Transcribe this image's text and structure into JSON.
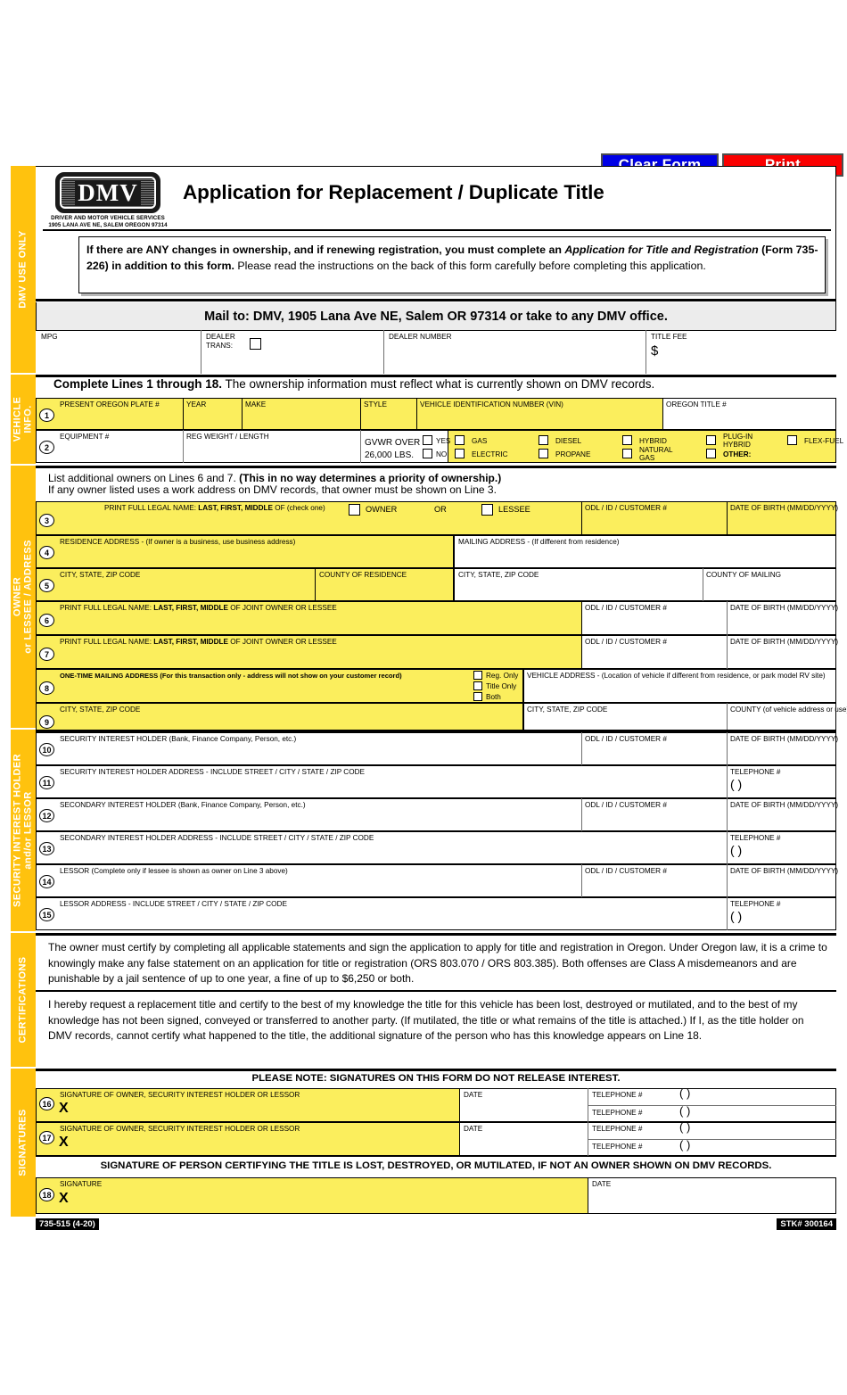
{
  "buttons": {
    "clear": "Clear Form",
    "print": "Print"
  },
  "header": {
    "logo_word": "DMV",
    "logo_sub_line1": "DRIVER AND MOTOR VEHICLE SERVICES",
    "logo_sub_line2": "1905 LANA AVE NE, SALEM OREGON 97314",
    "title": "Application for Replacement / Duplicate Title",
    "notice_html": "If there are ANY changes in ownership, and if renewing registration, you must complete an Application for Title and Registration (Form 735-226) in addition to this form. Please read the instructions on the back of this form carefully before completing this application.",
    "notice_b1": "If there are ANY changes in ownership, and if renewing registration, you must complete an ",
    "notice_i1": "Application for Title and Registration",
    "notice_b2": " (Form 735-226) in addition to this form. ",
    "notice_n1": "Please read the instructions on the back of this form carefully before completing this application.",
    "mail_to": "Mail to: DMV, 1905 Lana Ave NE, Salem OR 97314 or take to any DMV office."
  },
  "sidebars": {
    "dmv_use_only": "DMV USE ONLY",
    "vehicle_info_l1": "VEHICLE",
    "vehicle_info_l2": "INFO.",
    "owner_l1": "OWNER",
    "owner_l2": "or LESSEE / ADDRESS",
    "security_l1": "SECURITY INTEREST HOLDER",
    "security_l2": "and/or LESSOR",
    "certifications": "CERTIFICATIONS",
    "signatures": "SIGNATURES"
  },
  "dmv_use": {
    "mpg": "MPG",
    "dealer_trans_l1": "DEALER",
    "dealer_trans_l2": "TRANS:",
    "dealer_number": "DEALER NUMBER",
    "title_fee": "TITLE FEE",
    "dollar": "$"
  },
  "vehicle": {
    "complete_bold": "Complete Lines 1 through 18.",
    "complete_rest": " The ownership information must reflect what is currently shown on DMV records.",
    "line1": {
      "num": "1",
      "plate": "PRESENT OREGON PLATE #",
      "year": "YEAR",
      "make": "MAKE",
      "style": "STYLE",
      "vin": "VEHICLE IDENTIFICATION NUMBER (VIN)",
      "title_no": "OREGON TITLE #"
    },
    "line2": {
      "num": "2",
      "equipment": "EQUIPMENT #",
      "reg_weight": "REG WEIGHT / LENGTH",
      "gvwr_l1": "GVWR OVER",
      "gvwr_l2": "26,000 LBS.",
      "yes": "YES",
      "no": "NO",
      "fuels": [
        "GAS",
        "DIESEL",
        "HYBRID",
        "PLUG-IN HYBRID",
        "FLEX-FUEL",
        "ELECTRIC",
        "PROPANE",
        "NATURAL GAS",
        "OTHER:"
      ],
      "gas": "GAS",
      "diesel": "DIESEL",
      "hybrid": "HYBRID",
      "plugin_l1": "PLUG-IN",
      "plugin_l2": "HYBRID",
      "flexfuel": "FLEX-FUEL",
      "electric": "ELECTRIC",
      "propane": "PROPANE",
      "natural_l1": "NATURAL",
      "natural_l2": "GAS",
      "other": "OTHER:"
    }
  },
  "owner": {
    "note_l1_a": "List additional owners on Lines 6 and 7.  ",
    "note_l1_b": "(This in no way determines a priority of ownership.)",
    "note_l2": "If any owner listed uses a work address on DMV records, that owner must be shown on Line 3.",
    "line3": {
      "num": "3",
      "label_a": "PRINT FULL LEGAL NAME: ",
      "label_b": "LAST, FIRST, MIDDLE",
      "label_c": " OF (check one)",
      "owner": "OWNER",
      "or": "OR",
      "lessee": "LESSEE",
      "odl": "ODL / ID / CUSTOMER #",
      "dob": "DATE OF BIRTH  (MM/DD/YYYY)"
    },
    "line4": {
      "num": "4",
      "residence": "RESIDENCE ADDRESS - (If owner is a business, use business address)",
      "mailing": "MAILING ADDRESS - (If different from residence)"
    },
    "line5": {
      "num": "5",
      "city": "CITY, STATE, ZIP CODE",
      "county_res": "COUNTY OF RESIDENCE",
      "city2": "CITY, STATE, ZIP CODE",
      "county_mail": "COUNTY OF MAILING"
    },
    "line6": {
      "num": "6",
      "label_a": "PRINT FULL LEGAL NAME: ",
      "label_b": "LAST, FIRST, MIDDLE",
      "label_c": " OF JOINT OWNER OR LESSEE",
      "odl": "ODL / ID / CUSTOMER #",
      "dob": "DATE OF BIRTH  (MM/DD/YYYY)"
    },
    "line7": {
      "num": "7",
      "label_a": "PRINT FULL LEGAL NAME: ",
      "label_b": "LAST, FIRST, MIDDLE",
      "label_c": "  OF JOINT OWNER OR LESSEE",
      "odl": "ODL / ID / CUSTOMER #",
      "dob": "DATE OF BIRTH  (MM/DD/YYYY)"
    },
    "line8": {
      "num": "8",
      "label_b": "ONE-TIME MAILING ADDRESS ",
      "label_n": "(For this transaction only - address will not show on your customer record)",
      "reg_only": "Reg. Only",
      "title_only": "Title Only",
      "both": "Both",
      "vehicle_address": "VEHICLE ADDRESS - (Location of vehicle if different from residence, or park model RV site)"
    },
    "line9": {
      "num": "9",
      "city": "CITY, STATE, ZIP CODE",
      "city2": "CITY, STATE, ZIP CODE",
      "county": "COUNTY (of vehicle address or use)"
    }
  },
  "security": {
    "line10": {
      "num": "10",
      "label": "SECURITY INTEREST HOLDER (Bank, Finance Company, Person, etc.)",
      "odl": "ODL / ID / CUSTOMER #",
      "dob": "DATE OF BIRTH  (MM/DD/YYYY)"
    },
    "line11": {
      "num": "11",
      "label": "SECURITY INTEREST HOLDER ADDRESS - INCLUDE STREET / CITY / STATE / ZIP CODE",
      "tel": "TELEPHONE #",
      "paren": "(          )"
    },
    "line12": {
      "num": "12",
      "label": "SECONDARY INTEREST HOLDER (Bank, Finance Company, Person, etc.)",
      "odl": "ODL / ID / CUSTOMER #",
      "dob": "DATE OF BIRTH  (MM/DD/YYYY)"
    },
    "line13": {
      "num": "13",
      "label": "SECONDARY INTEREST HOLDER ADDRESS - INCLUDE STREET / CITY / STATE / ZIP CODE",
      "tel": "TELEPHONE #",
      "paren": "(          )"
    },
    "line14": {
      "num": "14",
      "label": "LESSOR (Complete only if lessee is shown as owner on Line 3 above)",
      "odl": "ODL / ID / CUSTOMER #",
      "dob": "DATE OF BIRTH  (MM/DD/YYYY)"
    },
    "line15": {
      "num": "15",
      "label": "LESSOR ADDRESS - INCLUDE STREET / CITY / STATE / ZIP CODE",
      "tel": "TELEPHONE #",
      "paren": "(          )"
    }
  },
  "certifications": {
    "para1": "The owner must certify by completing all applicable statements and sign the application to apply for title and registration in Oregon. Under Oregon law, it is a crime to knowingly make any false statement on an application for title or registration (ORS 803.070 / ORS 803.385). Both offenses are Class A misdemeanors and are punishable by a jail sentence of up to one year, a fine of up to $6,250 or both.",
    "para2": "I hereby request a replacement title and certify to the best of my knowledge the title for this vehicle has been lost, destroyed or mutilated, and to the best of my knowledge has not been signed, conveyed or transferred to another party. (If mutilated, the title or what remains of the title is attached.) If I, as the title holder on DMV records, cannot certify what happened to the title, the additional signature of the person who has this knowledge appears on Line 18."
  },
  "signatures": {
    "please_note": "PLEASE NOTE: SIGNATURES ON THIS FORM DO NOT RELEASE INTEREST.",
    "line16": {
      "num": "16",
      "label": "SIGNATURE OF OWNER, SECURITY INTEREST HOLDER OR LESSOR",
      "x": "X",
      "date": "DATE",
      "tel1": "TELEPHONE #",
      "tel2": "TELEPHONE #",
      "paren": "(          )"
    },
    "line17": {
      "num": "17",
      "label": "SIGNATURE OF OWNER, SECURITY INTEREST HOLDER OR LESSOR",
      "x": "X",
      "date": "DATE",
      "tel1": "TELEPHONE #",
      "tel2": "TELEPHONE #",
      "paren": "(          )"
    },
    "cert_header": "SIGNATURE OF PERSON CERTIFYING THE TITLE IS LOST, DESTROYED, OR MUTILATED, IF NOT AN OWNER SHOWN ON DMV RECORDS.",
    "line18": {
      "num": "18",
      "label": "SIGNATURE",
      "x": "X",
      "date": "DATE"
    }
  },
  "footer": {
    "form_number": "735-515 (4-20)",
    "stock": "STK# 300164"
  },
  "colors": {
    "accent": "#FFC20E",
    "field": "#FBEE5D",
    "clear": "#0000e6",
    "print": "#fa0000"
  }
}
